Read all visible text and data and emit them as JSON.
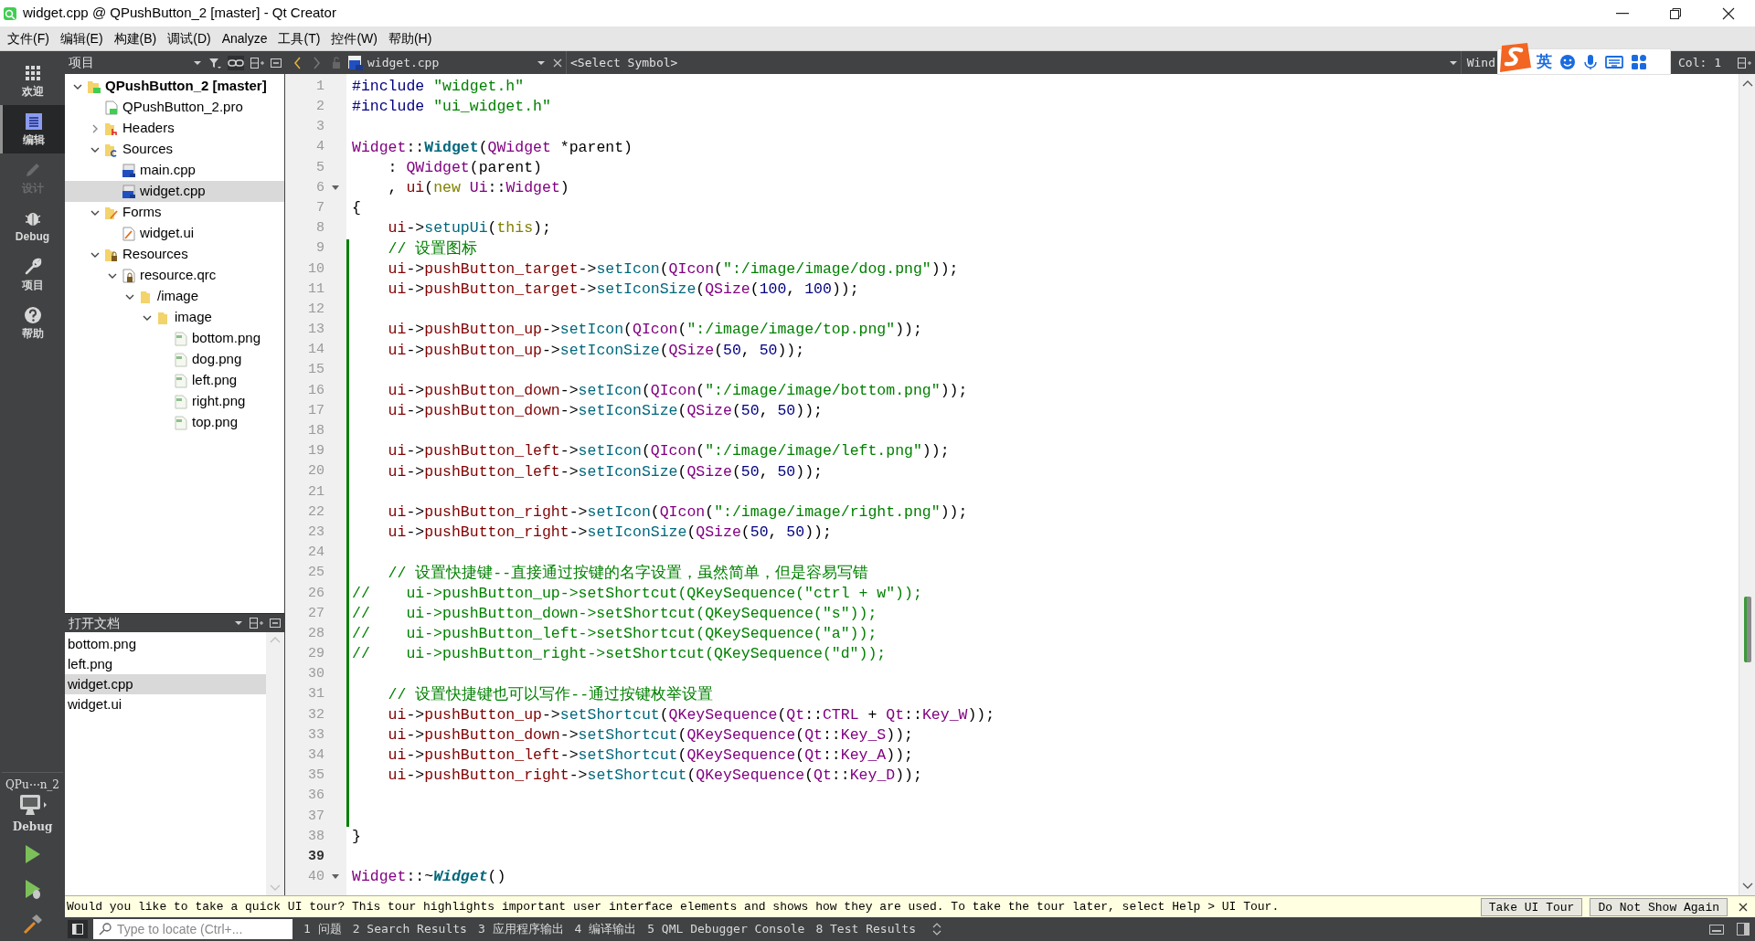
{
  "window": {
    "title": "widget.cpp @ QPushButton_2 [master] - Qt Creator"
  },
  "menu": [
    "文件(F)",
    "编辑(E)",
    "构建(B)",
    "调试(D)",
    "Analyze",
    "工具(T)",
    "控件(W)",
    "帮助(H)"
  ],
  "mode_bar": {
    "modes": [
      {
        "label": "欢迎",
        "kind": "welcome",
        "selected": false,
        "disabled": false
      },
      {
        "label": "编辑",
        "kind": "edit",
        "selected": true,
        "disabled": false
      },
      {
        "label": "设计",
        "kind": "design",
        "selected": false,
        "disabled": true
      },
      {
        "label": "Debug",
        "kind": "debug",
        "selected": false,
        "disabled": false
      },
      {
        "label": "项目",
        "kind": "projects",
        "selected": false,
        "disabled": false
      },
      {
        "label": "帮助",
        "kind": "help",
        "selected": false,
        "disabled": false
      }
    ],
    "target": {
      "project": "QPu⋯n_2",
      "configuration": "Debug"
    }
  },
  "project_panel": {
    "title": "项目",
    "tree": [
      {
        "label": "QPushButton_2 [master]",
        "kind": "project",
        "expanded": true,
        "selected": false,
        "children": [
          {
            "label": "QPushButton_2.pro",
            "kind": "pro",
            "selected": false
          },
          {
            "label": "Headers",
            "kind": "headers",
            "expanded": false,
            "selected": false
          },
          {
            "label": "Sources",
            "kind": "sources",
            "expanded": true,
            "selected": false,
            "children": [
              {
                "label": "main.cpp",
                "kind": "cpp",
                "selected": false
              },
              {
                "label": "widget.cpp",
                "kind": "cpp",
                "selected": true
              }
            ]
          },
          {
            "label": "Forms",
            "kind": "forms",
            "expanded": true,
            "selected": false,
            "children": [
              {
                "label": "widget.ui",
                "kind": "ui",
                "selected": false
              }
            ]
          },
          {
            "label": "Resources",
            "kind": "resources",
            "expanded": true,
            "selected": false,
            "children": [
              {
                "label": "resource.qrc",
                "kind": "qrc",
                "expanded": true,
                "selected": false,
                "children": [
                  {
                    "label": "/image",
                    "kind": "folder",
                    "expanded": true,
                    "selected": false,
                    "children": [
                      {
                        "label": "image",
                        "kind": "folder",
                        "expanded": true,
                        "selected": false,
                        "children": [
                          {
                            "label": "bottom.png",
                            "kind": "png",
                            "selected": false
                          },
                          {
                            "label": "dog.png",
                            "kind": "png",
                            "selected": false
                          },
                          {
                            "label": "left.png",
                            "kind": "png",
                            "selected": false
                          },
                          {
                            "label": "right.png",
                            "kind": "png",
                            "selected": false
                          },
                          {
                            "label": "top.png",
                            "kind": "png",
                            "selected": false
                          }
                        ]
                      }
                    ]
                  }
                ]
              }
            ]
          }
        ]
      }
    ]
  },
  "open_documents": {
    "title": "打开文档",
    "items": [
      {
        "label": "bottom.png",
        "selected": false
      },
      {
        "label": "left.png",
        "selected": false
      },
      {
        "label": "widget.cpp",
        "selected": true
      },
      {
        "label": "widget.ui",
        "selected": false
      }
    ]
  },
  "editor": {
    "file": "widget.cpp",
    "symbol": "<Select Symbol>",
    "window_label": "Wind",
    "position": "Col: 1",
    "lines": [
      {
        "number": "1",
        "modified": false,
        "current": false,
        "foldable": false,
        "tokens": [
          {
            "kind": "pre",
            "text": "#include "
          },
          {
            "kind": "str",
            "text": "\"widget.h\""
          }
        ]
      },
      {
        "number": "2",
        "modified": false,
        "current": false,
        "foldable": false,
        "tokens": [
          {
            "kind": "pre",
            "text": "#include "
          },
          {
            "kind": "str",
            "text": "\"ui_widget.h\""
          }
        ]
      },
      {
        "number": "3",
        "modified": false,
        "current": false,
        "foldable": false
      },
      {
        "number": "4",
        "modified": false,
        "current": false,
        "foldable": false,
        "tokens": [
          {
            "kind": "type",
            "text": "Widget"
          },
          {
            "kind": "text",
            "text": "::"
          },
          {
            "kind": "decl",
            "text": "Widget"
          },
          {
            "kind": "text",
            "text": "("
          },
          {
            "kind": "type",
            "text": "QWidget"
          },
          {
            "kind": "text",
            "text": " *parent)"
          }
        ]
      },
      {
        "number": "5",
        "modified": false,
        "current": false,
        "foldable": false,
        "tokens": [
          {
            "kind": "text",
            "text": "    : "
          },
          {
            "kind": "type",
            "text": "QWidget"
          },
          {
            "kind": "text",
            "text": "(parent)"
          }
        ]
      },
      {
        "number": "6",
        "modified": false,
        "current": false,
        "foldable": true,
        "tokens": [
          {
            "kind": "text",
            "text": "    , "
          },
          {
            "kind": "member",
            "text": "ui"
          },
          {
            "kind": "text",
            "text": "("
          },
          {
            "kind": "kw",
            "text": "new "
          },
          {
            "kind": "type",
            "text": "Ui"
          },
          {
            "kind": "text",
            "text": "::"
          },
          {
            "kind": "type",
            "text": "Widget"
          },
          {
            "kind": "text",
            "text": ")"
          }
        ]
      },
      {
        "number": "7",
        "modified": false,
        "current": false,
        "foldable": false,
        "tokens": [
          {
            "kind": "text",
            "text": "{"
          }
        ]
      },
      {
        "number": "8",
        "modified": false,
        "current": false,
        "foldable": false,
        "tokens": [
          {
            "kind": "member",
            "text": "    ui"
          },
          {
            "kind": "text",
            "text": "->"
          },
          {
            "kind": "func",
            "text": "setupUi"
          },
          {
            "kind": "text",
            "text": "("
          },
          {
            "kind": "kw",
            "text": "this"
          },
          {
            "kind": "text",
            "text": ");"
          }
        ]
      },
      {
        "number": "9",
        "modified": true,
        "current": false,
        "foldable": false,
        "tokens": [
          {
            "kind": "comment",
            "text": "    // 设置图标"
          }
        ]
      },
      {
        "number": "10",
        "modified": true,
        "current": false,
        "foldable": false,
        "tokens": [
          {
            "kind": "member",
            "text": "    ui"
          },
          {
            "kind": "text",
            "text": "->"
          },
          {
            "kind": "member",
            "text": "pushButton_target"
          },
          {
            "kind": "text",
            "text": "->"
          },
          {
            "kind": "func",
            "text": "setIcon"
          },
          {
            "kind": "text",
            "text": "("
          },
          {
            "kind": "type",
            "text": "QIcon"
          },
          {
            "kind": "text",
            "text": "("
          },
          {
            "kind": "str",
            "text": "\":/image/image/dog.png\""
          },
          {
            "kind": "text",
            "text": "));"
          }
        ]
      },
      {
        "number": "11",
        "modified": true,
        "current": false,
        "foldable": false,
        "tokens": [
          {
            "kind": "member",
            "text": "    ui"
          },
          {
            "kind": "text",
            "text": "->"
          },
          {
            "kind": "member",
            "text": "pushButton_target"
          },
          {
            "kind": "text",
            "text": "->"
          },
          {
            "kind": "func",
            "text": "setIconSize"
          },
          {
            "kind": "text",
            "text": "("
          },
          {
            "kind": "type",
            "text": "QSize"
          },
          {
            "kind": "text",
            "text": "("
          },
          {
            "kind": "num",
            "text": "100"
          },
          {
            "kind": "text",
            "text": ", "
          },
          {
            "kind": "num",
            "text": "100"
          },
          {
            "kind": "text",
            "text": "));"
          }
        ]
      },
      {
        "number": "12",
        "modified": true,
        "current": false,
        "foldable": false
      },
      {
        "number": "13",
        "modified": true,
        "current": false,
        "foldable": false,
        "tokens": [
          {
            "kind": "member",
            "text": "    ui"
          },
          {
            "kind": "text",
            "text": "->"
          },
          {
            "kind": "member",
            "text": "pushButton_up"
          },
          {
            "kind": "text",
            "text": "->"
          },
          {
            "kind": "func",
            "text": "setIcon"
          },
          {
            "kind": "text",
            "text": "("
          },
          {
            "kind": "type",
            "text": "QIcon"
          },
          {
            "kind": "text",
            "text": "("
          },
          {
            "kind": "str",
            "text": "\":/image/image/top.png\""
          },
          {
            "kind": "text",
            "text": "));"
          }
        ]
      },
      {
        "number": "14",
        "modified": true,
        "current": false,
        "foldable": false,
        "tokens": [
          {
            "kind": "member",
            "text": "    ui"
          },
          {
            "kind": "text",
            "text": "->"
          },
          {
            "kind": "member",
            "text": "pushButton_up"
          },
          {
            "kind": "text",
            "text": "->"
          },
          {
            "kind": "func",
            "text": "setIconSize"
          },
          {
            "kind": "text",
            "text": "("
          },
          {
            "kind": "type",
            "text": "QSize"
          },
          {
            "kind": "text",
            "text": "("
          },
          {
            "kind": "num",
            "text": "50"
          },
          {
            "kind": "text",
            "text": ", "
          },
          {
            "kind": "num",
            "text": "50"
          },
          {
            "kind": "text",
            "text": "));"
          }
        ]
      },
      {
        "number": "15",
        "modified": true,
        "current": false,
        "foldable": false
      },
      {
        "number": "16",
        "modified": true,
        "current": false,
        "foldable": false,
        "tokens": [
          {
            "kind": "member",
            "text": "    ui"
          },
          {
            "kind": "text",
            "text": "->"
          },
          {
            "kind": "member",
            "text": "pushButton_down"
          },
          {
            "kind": "text",
            "text": "->"
          },
          {
            "kind": "func",
            "text": "setIcon"
          },
          {
            "kind": "text",
            "text": "("
          },
          {
            "kind": "type",
            "text": "QIcon"
          },
          {
            "kind": "text",
            "text": "("
          },
          {
            "kind": "str",
            "text": "\":/image/image/bottom.png\""
          },
          {
            "kind": "text",
            "text": "));"
          }
        ]
      },
      {
        "number": "17",
        "modified": true,
        "current": false,
        "foldable": false,
        "tokens": [
          {
            "kind": "member",
            "text": "    ui"
          },
          {
            "kind": "text",
            "text": "->"
          },
          {
            "kind": "member",
            "text": "pushButton_down"
          },
          {
            "kind": "text",
            "text": "->"
          },
          {
            "kind": "func",
            "text": "setIconSize"
          },
          {
            "kind": "text",
            "text": "("
          },
          {
            "kind": "type",
            "text": "QSize"
          },
          {
            "kind": "text",
            "text": "("
          },
          {
            "kind": "num",
            "text": "50"
          },
          {
            "kind": "text",
            "text": ", "
          },
          {
            "kind": "num",
            "text": "50"
          },
          {
            "kind": "text",
            "text": "));"
          }
        ]
      },
      {
        "number": "18",
        "modified": true,
        "current": false,
        "foldable": false
      },
      {
        "number": "19",
        "modified": true,
        "current": false,
        "foldable": false,
        "tokens": [
          {
            "kind": "member",
            "text": "    ui"
          },
          {
            "kind": "text",
            "text": "->"
          },
          {
            "kind": "member",
            "text": "pushButton_left"
          },
          {
            "kind": "text",
            "text": "->"
          },
          {
            "kind": "func",
            "text": "setIcon"
          },
          {
            "kind": "text",
            "text": "("
          },
          {
            "kind": "type",
            "text": "QIcon"
          },
          {
            "kind": "text",
            "text": "("
          },
          {
            "kind": "str",
            "text": "\":/image/image/left.png\""
          },
          {
            "kind": "text",
            "text": "));"
          }
        ]
      },
      {
        "number": "20",
        "modified": true,
        "current": false,
        "foldable": false,
        "tokens": [
          {
            "kind": "member",
            "text": "    ui"
          },
          {
            "kind": "text",
            "text": "->"
          },
          {
            "kind": "member",
            "text": "pushButton_left"
          },
          {
            "kind": "text",
            "text": "->"
          },
          {
            "kind": "func",
            "text": "setIconSize"
          },
          {
            "kind": "text",
            "text": "("
          },
          {
            "kind": "type",
            "text": "QSize"
          },
          {
            "kind": "text",
            "text": "("
          },
          {
            "kind": "num",
            "text": "50"
          },
          {
            "kind": "text",
            "text": ", "
          },
          {
            "kind": "num",
            "text": "50"
          },
          {
            "kind": "text",
            "text": "));"
          }
        ]
      },
      {
        "number": "21",
        "modified": true,
        "current": false,
        "foldable": false
      },
      {
        "number": "22",
        "modified": true,
        "current": false,
        "foldable": false,
        "tokens": [
          {
            "kind": "member",
            "text": "    ui"
          },
          {
            "kind": "text",
            "text": "->"
          },
          {
            "kind": "member",
            "text": "pushButton_right"
          },
          {
            "kind": "text",
            "text": "->"
          },
          {
            "kind": "func",
            "text": "setIcon"
          },
          {
            "kind": "text",
            "text": "("
          },
          {
            "kind": "type",
            "text": "QIcon"
          },
          {
            "kind": "text",
            "text": "("
          },
          {
            "kind": "str",
            "text": "\":/image/image/right.png\""
          },
          {
            "kind": "text",
            "text": "));"
          }
        ]
      },
      {
        "number": "23",
        "modified": true,
        "current": false,
        "foldable": false,
        "tokens": [
          {
            "kind": "member",
            "text": "    ui"
          },
          {
            "kind": "text",
            "text": "->"
          },
          {
            "kind": "member",
            "text": "pushButton_right"
          },
          {
            "kind": "text",
            "text": "->"
          },
          {
            "kind": "func",
            "text": "setIconSize"
          },
          {
            "kind": "text",
            "text": "("
          },
          {
            "kind": "type",
            "text": "QSize"
          },
          {
            "kind": "text",
            "text": "("
          },
          {
            "kind": "num",
            "text": "50"
          },
          {
            "kind": "text",
            "text": ", "
          },
          {
            "kind": "num",
            "text": "50"
          },
          {
            "kind": "text",
            "text": "));"
          }
        ]
      },
      {
        "number": "24",
        "modified": true,
        "current": false,
        "foldable": false
      },
      {
        "number": "25",
        "modified": true,
        "current": false,
        "foldable": false,
        "tokens": [
          {
            "kind": "comment",
            "text": "    // 设置快捷键--直接通过按键的名字设置，虽然简单，但是容易写错"
          }
        ]
      },
      {
        "number": "26",
        "modified": true,
        "current": false,
        "foldable": false,
        "tokens": [
          {
            "kind": "comment",
            "text": "//    ui->pushButton_up->setShortcut(QKeySequence(\"ctrl + w\"));"
          }
        ]
      },
      {
        "number": "27",
        "modified": true,
        "current": false,
        "foldable": false,
        "tokens": [
          {
            "kind": "comment",
            "text": "//    ui->pushButton_down->setShortcut(QKeySequence(\"s\"));"
          }
        ]
      },
      {
        "number": "28",
        "modified": true,
        "current": false,
        "foldable": false,
        "tokens": [
          {
            "kind": "comment",
            "text": "//    ui->pushButton_left->setShortcut(QKeySequence(\"a\"));"
          }
        ]
      },
      {
        "number": "29",
        "modified": true,
        "current": false,
        "foldable": false,
        "tokens": [
          {
            "kind": "comment",
            "text": "//    ui->pushButton_right->setShortcut(QKeySequence(\"d\"));"
          }
        ]
      },
      {
        "number": "30",
        "modified": true,
        "current": false,
        "foldable": false
      },
      {
        "number": "31",
        "modified": true,
        "current": false,
        "foldable": false,
        "tokens": [
          {
            "kind": "comment",
            "text": "    // 设置快捷键也可以写作--通过按键枚举设置"
          }
        ]
      },
      {
        "number": "32",
        "modified": true,
        "current": false,
        "foldable": false,
        "tokens": [
          {
            "kind": "member",
            "text": "    ui"
          },
          {
            "kind": "text",
            "text": "->"
          },
          {
            "kind": "member",
            "text": "pushButton_up"
          },
          {
            "kind": "text",
            "text": "->"
          },
          {
            "kind": "func",
            "text": "setShortcut"
          },
          {
            "kind": "text",
            "text": "("
          },
          {
            "kind": "type",
            "text": "QKeySequence"
          },
          {
            "kind": "text",
            "text": "("
          },
          {
            "kind": "type",
            "text": "Qt"
          },
          {
            "kind": "text",
            "text": "::"
          },
          {
            "kind": "enum",
            "text": "CTRL"
          },
          {
            "kind": "text",
            "text": " + "
          },
          {
            "kind": "type",
            "text": "Qt"
          },
          {
            "kind": "text",
            "text": "::"
          },
          {
            "kind": "enum",
            "text": "Key_W"
          },
          {
            "kind": "text",
            "text": "));"
          }
        ]
      },
      {
        "number": "33",
        "modified": true,
        "current": false,
        "foldable": false,
        "tokens": [
          {
            "kind": "member",
            "text": "    ui"
          },
          {
            "kind": "text",
            "text": "->"
          },
          {
            "kind": "member",
            "text": "pushButton_down"
          },
          {
            "kind": "text",
            "text": "->"
          },
          {
            "kind": "func",
            "text": "setShortcut"
          },
          {
            "kind": "text",
            "text": "("
          },
          {
            "kind": "type",
            "text": "QKeySequence"
          },
          {
            "kind": "text",
            "text": "("
          },
          {
            "kind": "type",
            "text": "Qt"
          },
          {
            "kind": "text",
            "text": "::"
          },
          {
            "kind": "enum",
            "text": "Key_S"
          },
          {
            "kind": "text",
            "text": "));"
          }
        ]
      },
      {
        "number": "34",
        "modified": true,
        "current": false,
        "foldable": false,
        "tokens": [
          {
            "kind": "member",
            "text": "    ui"
          },
          {
            "kind": "text",
            "text": "->"
          },
          {
            "kind": "member",
            "text": "pushButton_left"
          },
          {
            "kind": "text",
            "text": "->"
          },
          {
            "kind": "func",
            "text": "setShortcut"
          },
          {
            "kind": "text",
            "text": "("
          },
          {
            "kind": "type",
            "text": "QKeySequence"
          },
          {
            "kind": "text",
            "text": "("
          },
          {
            "kind": "type",
            "text": "Qt"
          },
          {
            "kind": "text",
            "text": "::"
          },
          {
            "kind": "enum",
            "text": "Key_A"
          },
          {
            "kind": "text",
            "text": "));"
          }
        ]
      },
      {
        "number": "35",
        "modified": true,
        "current": false,
        "foldable": false,
        "tokens": [
          {
            "kind": "member",
            "text": "    ui"
          },
          {
            "kind": "text",
            "text": "->"
          },
          {
            "kind": "member",
            "text": "pushButton_right"
          },
          {
            "kind": "text",
            "text": "->"
          },
          {
            "kind": "func",
            "text": "setShortcut"
          },
          {
            "kind": "text",
            "text": "("
          },
          {
            "kind": "type",
            "text": "QKeySequence"
          },
          {
            "kind": "text",
            "text": "("
          },
          {
            "kind": "type",
            "text": "Qt"
          },
          {
            "kind": "text",
            "text": "::"
          },
          {
            "kind": "enum",
            "text": "Key_D"
          },
          {
            "kind": "text",
            "text": "));"
          }
        ]
      },
      {
        "number": "36",
        "modified": true,
        "current": false,
        "foldable": false
      },
      {
        "number": "37",
        "modified": true,
        "current": false,
        "foldable": false
      },
      {
        "number": "38",
        "modified": false,
        "current": false,
        "foldable": false,
        "tokens": [
          {
            "kind": "text",
            "text": "}"
          }
        ]
      },
      {
        "number": "39",
        "modified": false,
        "current": true,
        "foldable": false
      },
      {
        "number": "40",
        "modified": false,
        "current": false,
        "foldable": true,
        "tokens": [
          {
            "kind": "type",
            "text": "Widget"
          },
          {
            "kind": "text",
            "text": "::~"
          },
          {
            "kind": "virt",
            "text": "Widget"
          },
          {
            "kind": "text",
            "text": "()"
          }
        ]
      }
    ]
  },
  "ime_bar": {
    "language": "英"
  },
  "tour_bar": {
    "message": "Would you like to take a quick UI tour? This tour highlights important user interface elements and shows how they are used. To take the tour later, select Help > UI Tour.",
    "buttons": [
      "Take UI Tour",
      "Do Not Show Again"
    ]
  },
  "status_bar": {
    "locator_placeholder": "Type to locate (Ctrl+...",
    "panes": [
      "1 问题",
      "2 Search Results",
      "3 应用程序输出",
      "4 编译输出",
      "5 QML Debugger Console",
      "8 Test Results"
    ]
  }
}
